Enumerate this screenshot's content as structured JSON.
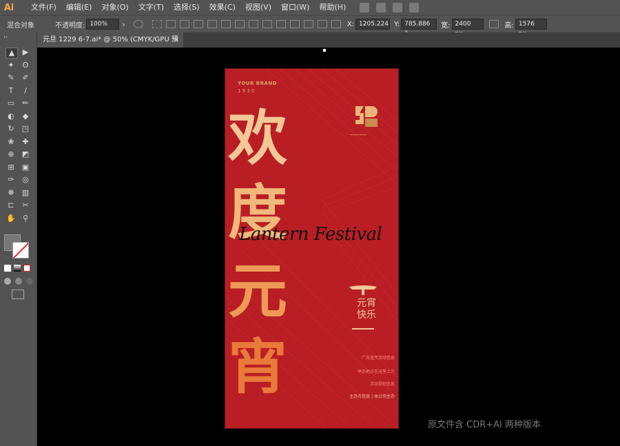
{
  "app": {
    "logo": "Ai"
  },
  "menu": [
    {
      "label": "文件(F)"
    },
    {
      "label": "编辑(E)"
    },
    {
      "label": "对象(O)"
    },
    {
      "label": "文字(T)"
    },
    {
      "label": "选择(S)"
    },
    {
      "label": "效果(C)"
    },
    {
      "label": "视图(V)"
    },
    {
      "label": "窗口(W)"
    },
    {
      "label": "帮助(H)"
    }
  ],
  "top_icons": [
    "bridge-icon",
    "stock-icon",
    "workspace-icon",
    "rocket-icon"
  ],
  "control_bar": {
    "selection_label": "混合对象",
    "opacity_label": "不透明度:",
    "opacity_value": "100%",
    "x_label": "X:",
    "x_value": "1205.224",
    "y_label": "Y:",
    "y_value": "785.886 1",
    "w_label": "宽:",
    "w_value": "2400 px",
    "h_label": "高:",
    "h_value": "1576 px"
  },
  "document_tab": {
    "title": "元旦 1229 6-7.ai* @ 50% (CMYK/GPU 预览)",
    "close": "×"
  },
  "tools": [
    "selection-tool-icon",
    "direct-selection-tool-icon",
    "magic-wand-tool-icon",
    "lasso-tool-icon",
    "pen-tool-icon",
    "curvature-tool-icon",
    "type-tool-icon",
    "line-tool-icon",
    "rectangle-tool-icon",
    "paintbrush-tool-icon",
    "shaper-tool-icon",
    "eraser-tool-icon",
    "rotate-tool-icon",
    "scale-tool-icon",
    "warp-tool-icon",
    "puppet-warp-tool-icon",
    "shape-builder-tool-icon",
    "perspective-tool-icon",
    "mesh-tool-icon",
    "gradient-tool-icon",
    "eyedropper-tool-icon",
    "blend-tool-icon",
    "symbol-sprayer-tool-icon",
    "graph-tool-icon",
    "artboard-tool-icon",
    "slice-tool-icon",
    "hand-tool-icon",
    "zoom-tool-icon"
  ],
  "artwork": {
    "brand": "YOUR BRAND",
    "year": "1 9 3 0",
    "chars": [
      "欢",
      "度",
      "元",
      "宵"
    ],
    "script": "Lantern Festival",
    "badge_line1": "元宵",
    "badge_line2": "快乐",
    "info_lines": [
      "广告宣传活动信息",
      "举办地点在这里上方",
      "活动规划信息",
      "主办方信息 | 本公司主办"
    ]
  },
  "watermark": "原文件含 CDR+AI 两种版本",
  "colors": {
    "artboard_red": "#b81e24",
    "gold": "#f1c38e",
    "ui_gray": "#535353"
  }
}
